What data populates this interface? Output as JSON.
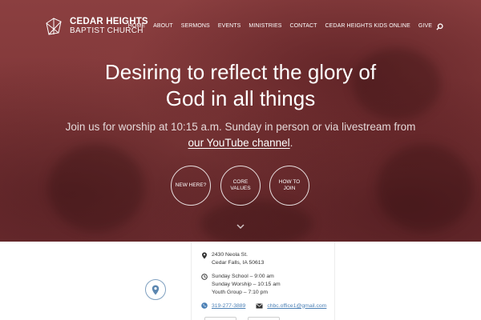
{
  "site": {
    "logo_line1": "CEDAR HEIGHTS",
    "logo_line2": "BAPTIST CHURCH"
  },
  "nav": {
    "items": [
      "HOME",
      "ABOUT",
      "SERMONS",
      "EVENTS",
      "MINISTRIES",
      "CONTACT",
      "CEDAR HEIGHTS KIDS ONLINE",
      "GIVE"
    ],
    "search_icon": "search-icon"
  },
  "hero": {
    "headline_line1": "Desiring to reflect the glory of",
    "headline_line2": "God in all things",
    "sub_line1": "Join us for worship at 10:15 a.m. Sunday in person or via livestream from",
    "sub_link": "our YouTube channel",
    "sub_end": ".",
    "buttons": [
      {
        "label": "NEW HERE?"
      },
      {
        "label": "CORE VALUES"
      },
      {
        "label": "HOW TO JOIN"
      }
    ],
    "scroll_icon": "chevron-down-icon"
  },
  "info": {
    "address_line1": "2430 Neola St.",
    "address_line2": "Cedar Falls, IA 50613",
    "schedule": [
      "Sunday School – 9:00 am",
      "Sunday Worship – 10:15 am",
      "Youth Group – 7:10 pm"
    ],
    "phone": "319-277-3889",
    "email": "chbc.office1@gmail.com"
  },
  "colors": {
    "hero_overlay": "#7e3537",
    "link": "#4a7fb5"
  }
}
